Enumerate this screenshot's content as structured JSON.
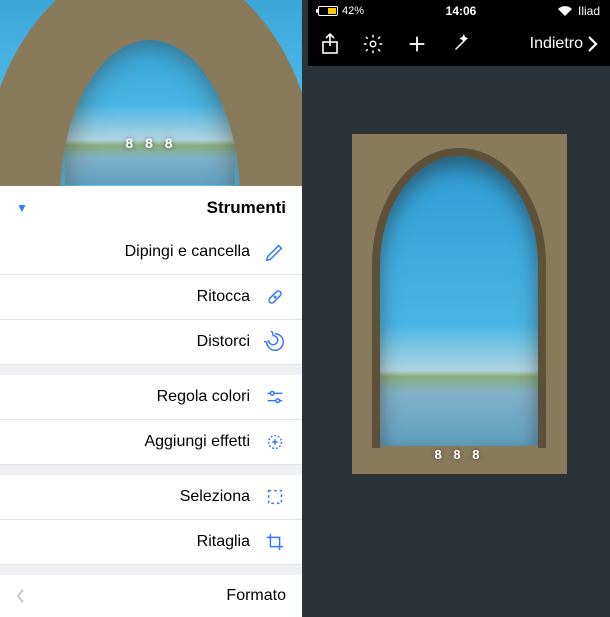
{
  "status": {
    "carrier": "Iliad",
    "time": "14:06",
    "battery_pct": "42%"
  },
  "toolbar": {
    "back_label": "Indietro"
  },
  "tools": {
    "header": "Strumenti",
    "items": [
      {
        "label": "Dipingi e cancella",
        "icon": "brush-icon"
      },
      {
        "label": "Ritocca",
        "icon": "bandage-icon"
      },
      {
        "label": "Distorci",
        "icon": "spiral-icon"
      }
    ],
    "adjust": [
      {
        "label": "Regola colori",
        "icon": "sliders-icon"
      },
      {
        "label": "Aggiungi effetti",
        "icon": "sparkle-icon"
      }
    ],
    "geometry": [
      {
        "label": "Seleziona",
        "icon": "select-icon"
      },
      {
        "label": "Ritaglia",
        "icon": "crop-icon"
      }
    ],
    "format_label": "Formato"
  },
  "watermark": "8  8  8"
}
